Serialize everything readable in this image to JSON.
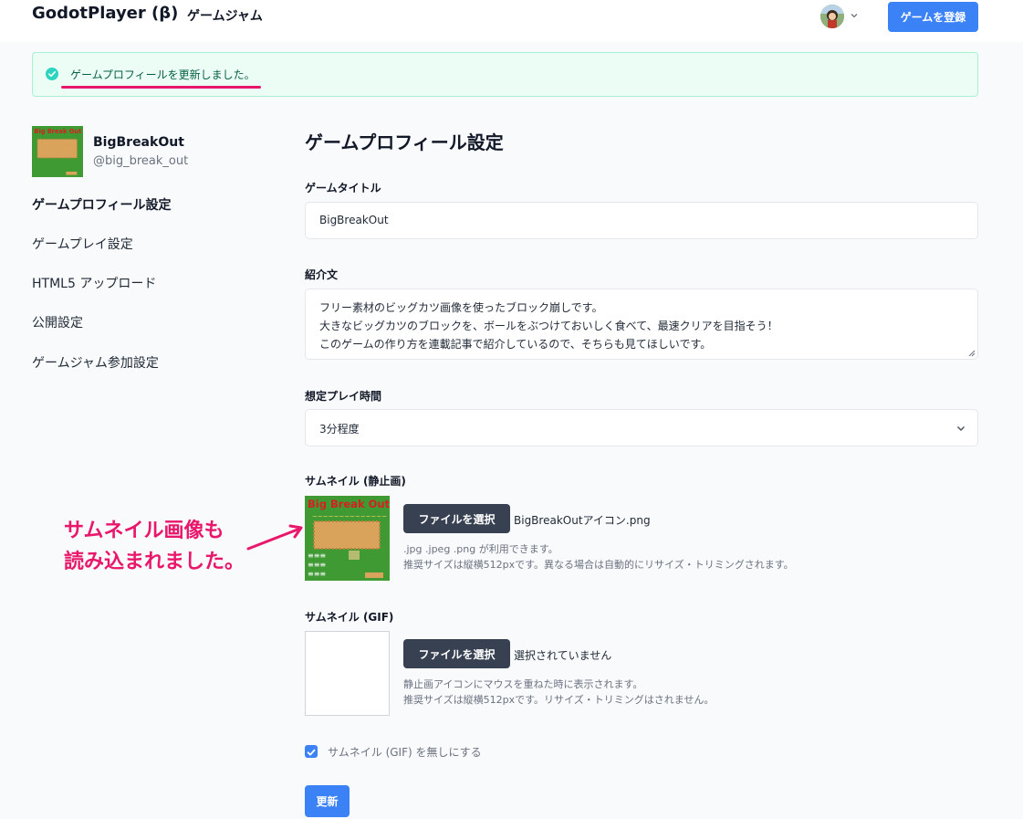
{
  "header": {
    "brand": "GodotPlayer (β)",
    "nav_link": "ゲームジャム",
    "register_button": "ゲームを登録"
  },
  "flash": {
    "message": "ゲームプロフィールを更新しました。"
  },
  "sidebar": {
    "game_name": "BigBreakOut",
    "game_handle": "@big_break_out",
    "items": [
      {
        "label": "ゲームプロフィール設定",
        "active": true
      },
      {
        "label": "ゲームプレイ設定",
        "active": false
      },
      {
        "label": "HTML5 アップロード",
        "active": false
      },
      {
        "label": "公開設定",
        "active": false
      },
      {
        "label": "ゲームジャム参加設定",
        "active": false
      }
    ]
  },
  "form": {
    "page_title": "ゲームプロフィール設定",
    "title_label": "ゲームタイトル",
    "title_value": "BigBreakOut",
    "description_label": "紹介文",
    "description_lines": [
      "フリー素材のビッグカツ画像を使ったブロック崩しです。",
      "大きなビッグカツのブロックを、ボールをぶつけておいしく食べて、最速クリアを目指そう！",
      "このゲームの作り方を連載記事で紹介しているので、そちらも見てほしいです。"
    ],
    "playtime_label": "想定プレイ時間",
    "playtime_value": "3分程度",
    "thumb_static_label": "サムネイル (静止画)",
    "thumb_static_button": "ファイルを選択",
    "thumb_static_filename": "BigBreakOutアイコン.png",
    "thumb_static_help": [
      ".jpg .jpeg .png が利用できます。",
      "推奨サイズは縦横512pxです。異なる場合は自動的にリサイズ・トリミングされます。"
    ],
    "thumb_gif_label": "サムネイル (GIF)",
    "thumb_gif_button": "ファイルを選択",
    "thumb_gif_filename": "選択されていません",
    "thumb_gif_help": [
      "静止画アイコンにマウスを重ねた時に表示されます。",
      "推奨サイズは縦横512pxです。リサイズ・トリミングはされません。"
    ],
    "remove_gif_label": "サムネイル (GIF) を無しにする",
    "remove_gif_checked": true,
    "submit_button": "更新"
  },
  "annotation": {
    "lines": [
      "サムネイル画像も",
      "読み込まれました。"
    ]
  },
  "colors": {
    "primary": "#3b82f6",
    "dark_button": "#374151",
    "success_bg": "#ecfdf5",
    "success_icon": "#2dd4bf",
    "annotation": "#e8176b"
  }
}
